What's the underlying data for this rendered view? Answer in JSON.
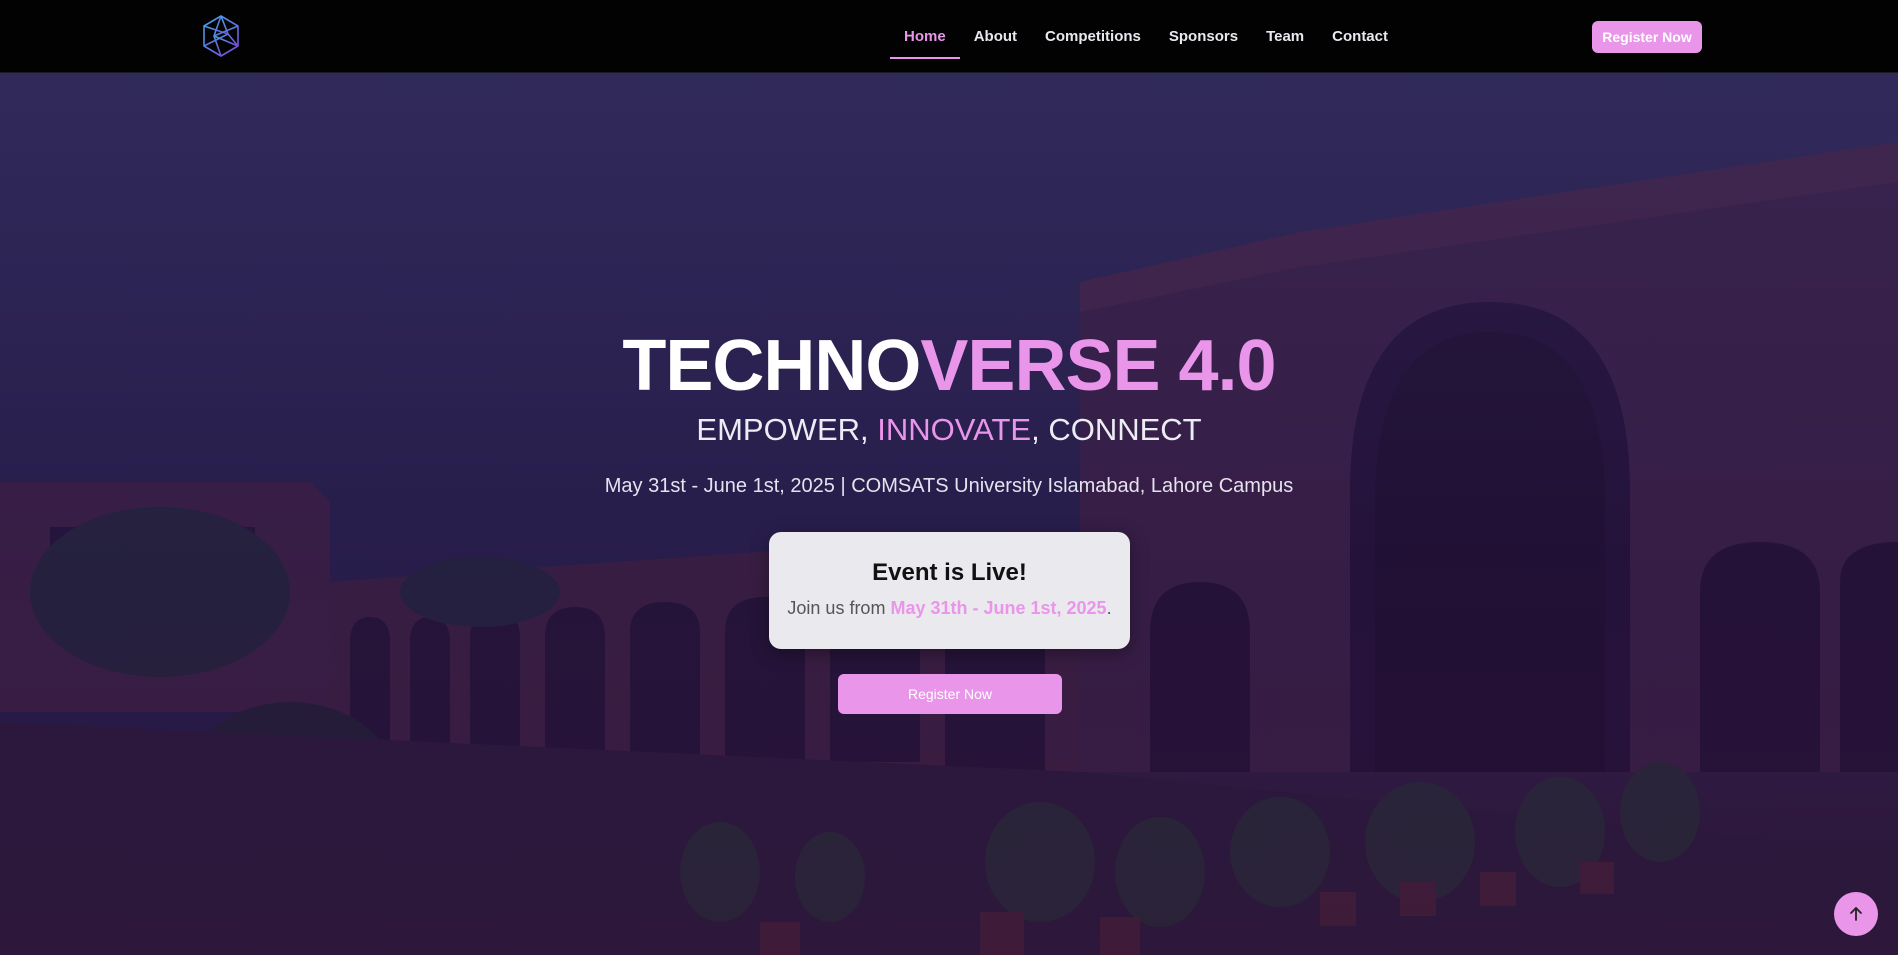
{
  "nav": {
    "logo_icon": "geodesic-logo-icon",
    "links": [
      {
        "label": "Home",
        "active": true
      },
      {
        "label": "About",
        "active": false
      },
      {
        "label": "Competitions",
        "active": false
      },
      {
        "label": "Sponsors",
        "active": false
      },
      {
        "label": "Team",
        "active": false
      },
      {
        "label": "Contact",
        "active": false
      }
    ],
    "register_label": "Register Now"
  },
  "hero": {
    "title_part1": "TECHNO",
    "title_part2": "VERSE 4.0",
    "tagline_part1": "EMPOWER, ",
    "tagline_part2": "INNOVATE",
    "tagline_part3": ", CONNECT",
    "info": "May 31st - June 1st, 2025 | COMSATS University Islamabad, Lahore Campus",
    "live_card": {
      "title": "Event is Live!",
      "text_prefix": "Join us from ",
      "text_dates": "May 31th - June 1st, 2025",
      "text_suffix": "."
    },
    "register_label": "Register Now"
  },
  "scroll_top": {
    "icon": "arrow-up-icon"
  },
  "colors": {
    "accent": "#e995e9",
    "nav_bg": "#020203"
  }
}
